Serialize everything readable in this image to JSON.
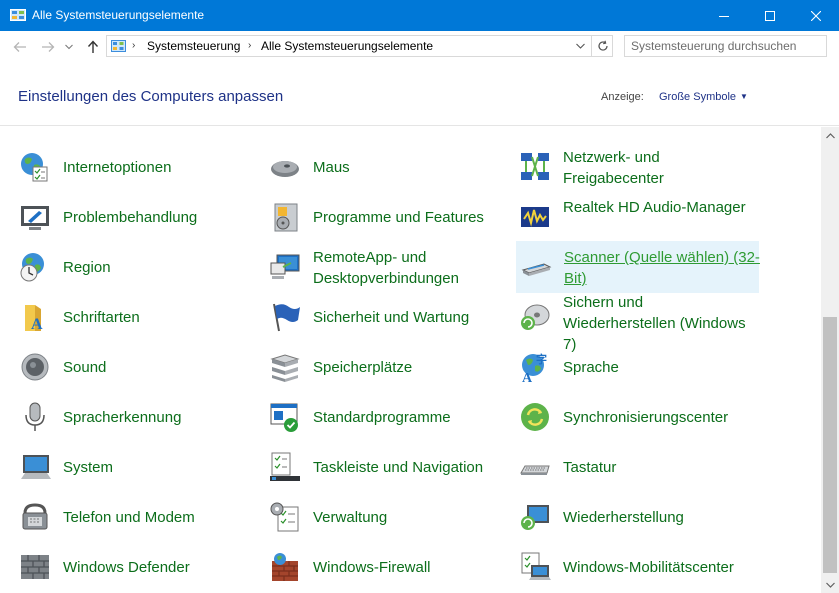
{
  "window": {
    "title": "Alle Systemsteuerungselemente"
  },
  "address": {
    "crumbs": [
      "Systemsteuerung",
      "Alle Systemsteuerungselemente"
    ]
  },
  "search": {
    "placeholder": "Systemsteuerung durchsuchen"
  },
  "header": {
    "title": "Einstellungen des Computers anpassen",
    "view_label": "Anzeige:",
    "view_value": "Große Symbole"
  },
  "items": [
    {
      "label": "Internetoptionen",
      "icon": "internet-options-icon"
    },
    {
      "label": "Maus",
      "icon": "mouse-icon"
    },
    {
      "label": "Netzwerk- und Freigabecenter",
      "icon": "network-icon"
    },
    {
      "label": "Problembehandlung",
      "icon": "troubleshoot-icon"
    },
    {
      "label": "Programme und Features",
      "icon": "programs-icon"
    },
    {
      "label": "Realtek HD Audio-Manager",
      "icon": "realtek-icon"
    },
    {
      "label": "Region",
      "icon": "region-icon"
    },
    {
      "label": "RemoteApp- und Desktopverbindungen",
      "icon": "remote-icon"
    },
    {
      "label": "Scanner (Quelle wählen) (32-Bit)",
      "icon": "scanner-icon"
    },
    {
      "label": "Schriftarten",
      "icon": "fonts-icon"
    },
    {
      "label": "Sicherheit und Wartung",
      "icon": "flag-icon"
    },
    {
      "label": "Sichern und Wiederherstellen (Windows 7)",
      "icon": "backup-icon"
    },
    {
      "label": "Sound",
      "icon": "speaker-icon"
    },
    {
      "label": "Speicherplätze",
      "icon": "storage-icon"
    },
    {
      "label": "Sprache",
      "icon": "language-icon"
    },
    {
      "label": "Spracherkennung",
      "icon": "microphone-icon"
    },
    {
      "label": "Standardprogramme",
      "icon": "default-programs-icon"
    },
    {
      "label": "Synchronisierungscenter",
      "icon": "sync-icon"
    },
    {
      "label": "System",
      "icon": "system-icon"
    },
    {
      "label": "Taskleiste und Navigation",
      "icon": "taskbar-icon"
    },
    {
      "label": "Tastatur",
      "icon": "keyboard-icon"
    },
    {
      "label": "Telefon und Modem",
      "icon": "phone-icon"
    },
    {
      "label": "Verwaltung",
      "icon": "admin-tools-icon"
    },
    {
      "label": "Wiederherstellung",
      "icon": "recovery-icon"
    },
    {
      "label": "Windows Defender",
      "icon": "defender-icon"
    },
    {
      "label": "Windows-Firewall",
      "icon": "firewall-icon"
    },
    {
      "label": "Windows-Mobilitätscenter",
      "icon": "mobility-icon"
    }
  ]
}
